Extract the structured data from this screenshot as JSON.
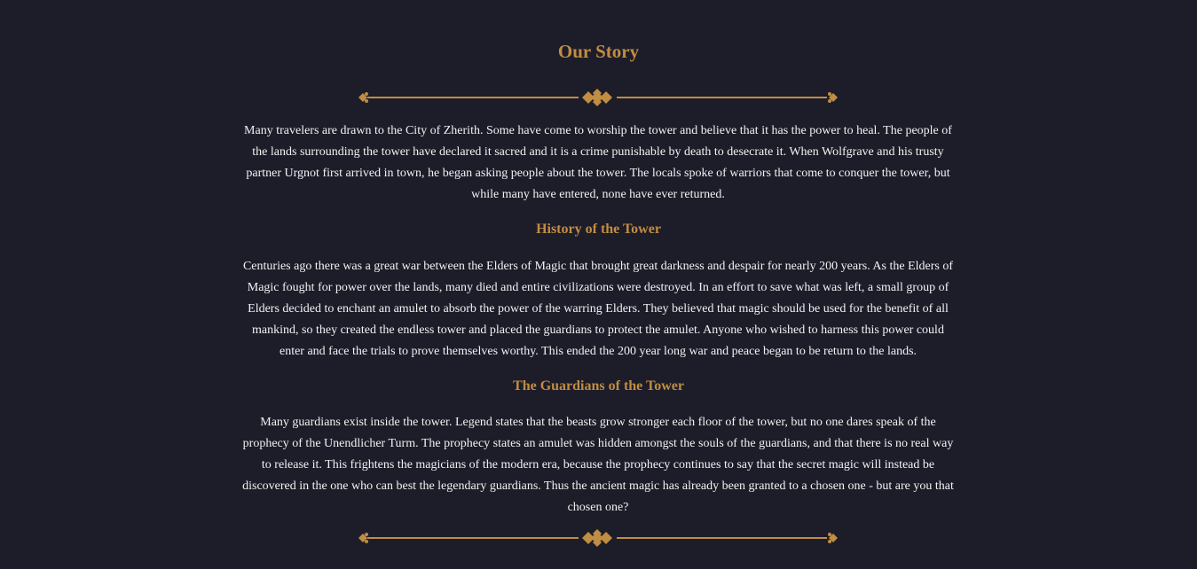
{
  "colors": {
    "background": "#1d1c29",
    "accent": "#c08d42",
    "text": "#f2f2f2"
  },
  "story": {
    "title": "Our Story",
    "intro": "Many travelers are drawn to the City of Zherith. Some have come to worship the tower and believe that it has the power to heal. The people of the lands surrounding the tower have declared it sacred and it is a crime punishable by death to desecrate it. When Wolfgrave and his trusty partner Urgnot first arrived in town, he began asking people about the tower. The locals spoke of warriors that come to conquer the tower, but while many have entered, none have ever returned.",
    "sections": [
      {
        "heading": "History of the Tower",
        "body": "Centuries ago there was a great war between the Elders of Magic that brought great darkness and despair for nearly 200 years. As the Elders of Magic fought for power over the lands, many died and entire civilizations were destroyed. In an effort to save what was left, a small group of Elders decided to enchant an amulet to absorb the power of the warring Elders. They believed that magic should be used for the benefit of all mankind, so they created the endless tower and placed the guardians to protect the amulet. Anyone who wished to harness this power could enter and face the trials to prove themselves worthy. This ended the 200 year long war and peace began to be return to the lands."
      },
      {
        "heading": "The Guardians of the Tower",
        "body": "Many guardians exist inside the tower. Legend states that the beasts grow stronger each floor of the tower, but no one dares speak of the prophecy of the Unendlicher Turm. The prophecy states an amulet was hidden amongst the souls of the guardians, and that there is no real way to release it. This frightens the magicians of the modern era, because the prophecy continues to say that the secret magic will instead be discovered in the one who can best the legendary guardians. Thus the ancient magic has already been granted to a chosen one - but are you that chosen one?"
      }
    ]
  },
  "icons": {
    "divider": "ornamental-divider-icon"
  }
}
